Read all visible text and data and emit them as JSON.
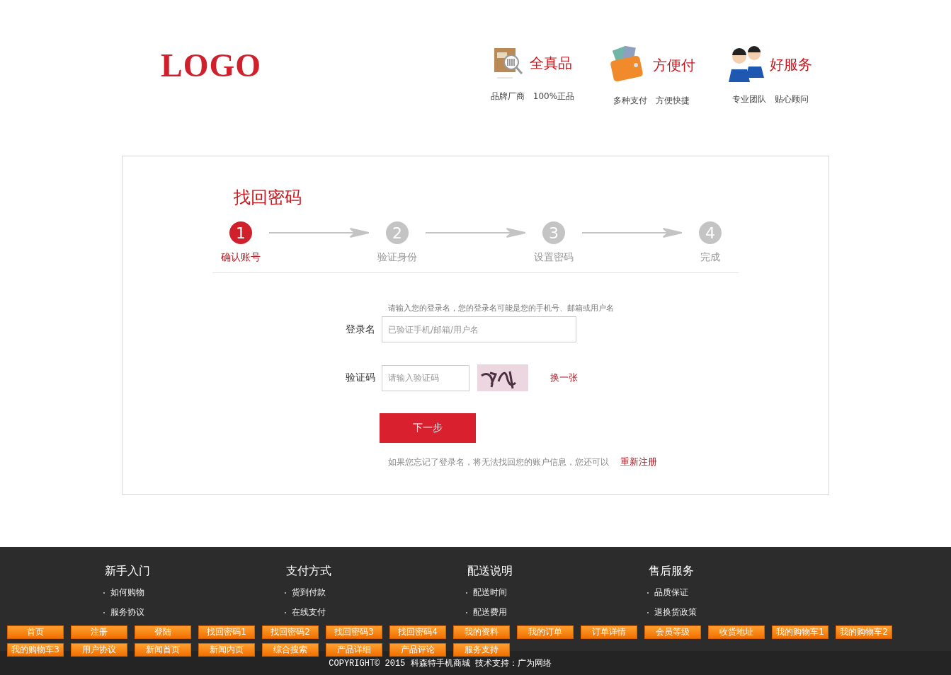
{
  "header": {
    "logo": "LOGO",
    "features": [
      {
        "kind": "box",
        "title": "全真品",
        "subtitle": [
          "品牌厂商",
          "100%正品"
        ]
      },
      {
        "kind": "wallet",
        "title": "方便付",
        "subtitle": [
          "多种支付",
          "方便快捷"
        ]
      },
      {
        "kind": "people",
        "title": "好服务",
        "subtitle": [
          "专业团队",
          "贴心顾问"
        ]
      }
    ]
  },
  "form": {
    "title": "找回密码",
    "steps": [
      {
        "number": "1",
        "label": "确认账号",
        "selected": true
      },
      {
        "number": "2",
        "label": "验证身份",
        "selected": false
      },
      {
        "number": "3",
        "label": "设置密码",
        "selected": false
      },
      {
        "number": "4",
        "label": "完成",
        "selected": false
      }
    ],
    "hint": "请输入您的登录名，您的登录名可能是您的手机号、邮箱或用户名",
    "login_label": "登录名",
    "login_placeholder": "已验证手机/邮箱/用户名",
    "captcha_label": "验证码",
    "captcha_placeholder": "请输入验证码",
    "captcha_refresh": "换一张",
    "submit": "下一步",
    "note": "如果您忘记了登录名，将无法找回您的账户信息，您还可以",
    "register_link": "重新注册"
  },
  "footer": {
    "columns": [
      {
        "title": "新手入门",
        "items": [
          "如何购物",
          "服务协议"
        ]
      },
      {
        "title": "支付方式",
        "items": [
          "货到付款",
          "在线支付"
        ]
      },
      {
        "title": "配送说明",
        "items": [
          "配送时间",
          "配送费用"
        ]
      },
      {
        "title": "售后服务",
        "items": [
          "品质保证",
          "退换货政策"
        ]
      }
    ],
    "nav": [
      "首页",
      "注册",
      "登陆",
      "找回密码1",
      "找回密码2",
      "找回密码3",
      "找回密码4",
      "我的资料",
      "我的订单",
      "订单详情",
      "会员等级",
      "收货地址",
      "我的购物车1",
      "我的购物车2",
      "我的购物车3",
      "用户协议",
      "新闻首页",
      "新闻内页",
      "综合搜索",
      "产品详细",
      "产品评论",
      "服务支持"
    ],
    "copyright": "COPYRIGHT© 2015 科森特手机商城 技术支持：广为网络"
  }
}
